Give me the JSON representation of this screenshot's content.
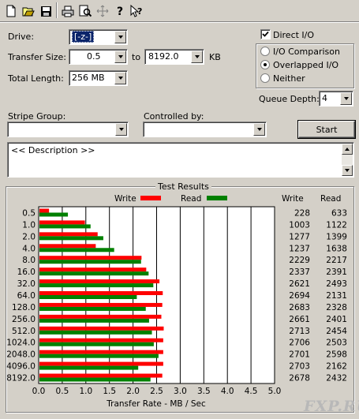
{
  "toolbar": {
    "buttons": [
      "new-icon",
      "open-icon",
      "save-icon",
      "print-icon",
      "print-preview-icon",
      "move-icon",
      "help-icon",
      "context-help-icon"
    ]
  },
  "drive": {
    "label": "Drive:",
    "value": "[-z-]"
  },
  "transfer_size": {
    "label": "Transfer Size:",
    "from": "0.5",
    "to_label": "to",
    "to": "8192.0",
    "unit": "KB"
  },
  "total_length": {
    "label": "Total Length:",
    "value": "256 MB"
  },
  "options": {
    "direct_io": "Direct I/O",
    "io_comparison": "I/O Comparison",
    "overlapped_io": "Overlapped I/O",
    "neither": "Neither",
    "queue_depth_label": "Queue Depth:",
    "queue_depth": "4"
  },
  "stripe_group": {
    "label": "Stripe Group:",
    "value": ""
  },
  "controlled_by": {
    "label": "Controlled by:",
    "value": ""
  },
  "start_label": "Start",
  "description": "<< Description >>",
  "results": {
    "title": "Test Results",
    "write_legend": "Write",
    "read_legend": "Read",
    "write_col": "Write",
    "read_col": "Read"
  },
  "watermark": "FXP.RU",
  "colors": {
    "write": "#ff0000",
    "read": "#008000",
    "plot_bg": "#ffffff"
  },
  "chart_data": {
    "type": "bar",
    "orientation": "horizontal",
    "xlabel": "Transfer Rate - MB / Sec",
    "xlim": [
      0,
      5
    ],
    "xticks": [
      "0.0",
      "0.5",
      "1.0",
      "1.5",
      "2.0",
      "2.5",
      "3.0",
      "3.5",
      "4.0",
      "4.5",
      "5.0"
    ],
    "grid": true,
    "categories": [
      "0.5",
      "1.0",
      "2.0",
      "4.0",
      "8.0",
      "16.0",
      "32.0",
      "64.0",
      "128.0",
      "256.0",
      "512.0",
      "1024.0",
      "2048.0",
      "4096.0",
      "8192.0"
    ],
    "series": [
      {
        "name": "Write",
        "values": [
          0.22,
          0.98,
          1.25,
          1.21,
          2.18,
          2.28,
          2.56,
          2.63,
          2.62,
          2.6,
          2.65,
          2.64,
          2.64,
          2.64,
          2.62
        ]
      },
      {
        "name": "Read",
        "values": [
          0.62,
          1.1,
          1.37,
          1.6,
          2.17,
          2.33,
          2.43,
          2.08,
          2.27,
          2.34,
          2.4,
          2.44,
          2.54,
          2.11,
          2.37
        ]
      }
    ],
    "table": {
      "write": [
        "228",
        "1003",
        "1277",
        "1237",
        "2229",
        "2337",
        "2621",
        "2694",
        "2683",
        "2661",
        "2713",
        "2706",
        "2701",
        "2703",
        "2678"
      ],
      "read": [
        "633",
        "1122",
        "1399",
        "1638",
        "2217",
        "2391",
        "2493",
        "2131",
        "2328",
        "2401",
        "2454",
        "2503",
        "2598",
        "2162",
        "2432"
      ]
    }
  }
}
